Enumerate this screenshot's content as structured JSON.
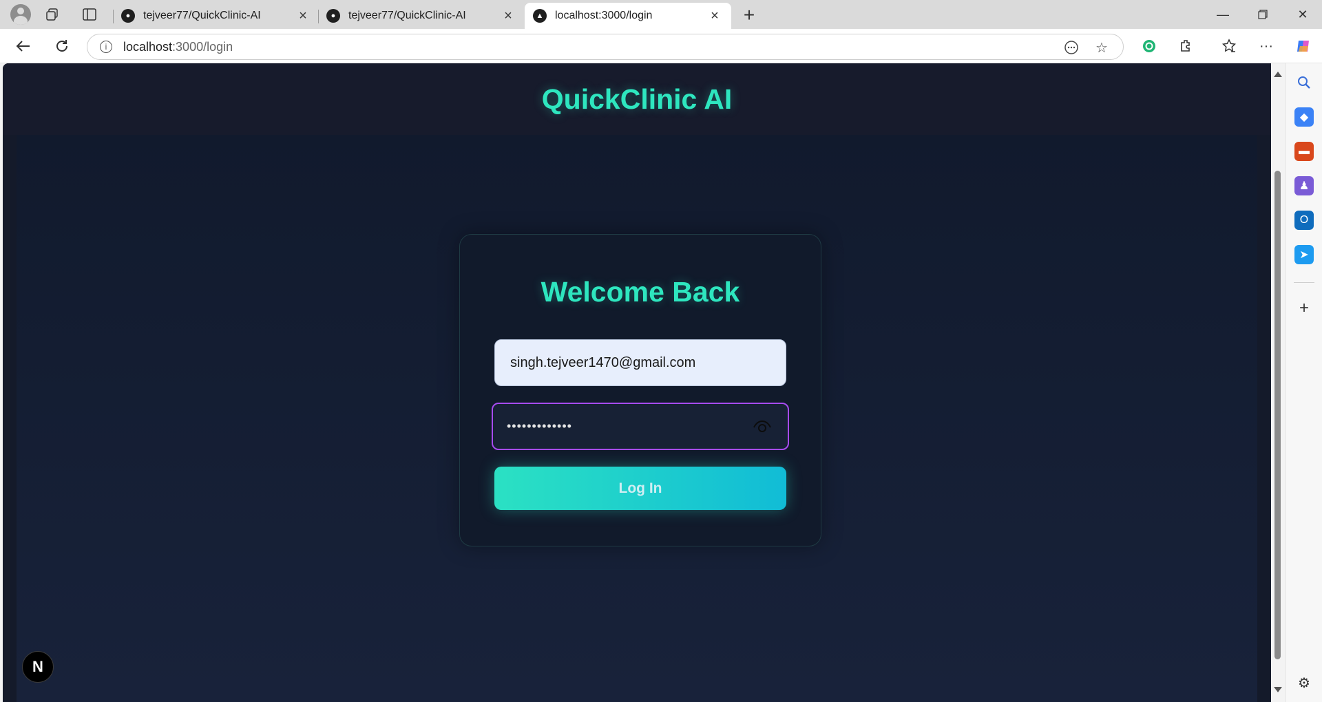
{
  "browser": {
    "tabs": [
      {
        "title": "tejveer77/QuickClinic-AI",
        "favicon": "github-icon",
        "active": false
      },
      {
        "title": "tejveer77/QuickClinic-AI",
        "favicon": "github-icon",
        "active": false
      },
      {
        "title": "localhost:3000/login",
        "favicon": "nextjs-icon",
        "active": true
      }
    ],
    "address": {
      "host": "localhost",
      "path": ":3000/login"
    }
  },
  "app": {
    "brand": "QuickClinic AI",
    "login": {
      "title": "Welcome Back",
      "email_value": "singh.tejveer1470@gmail.com",
      "password_mask": "•••••••••••••",
      "button_label": "Log In"
    },
    "dev_badge": "N"
  },
  "colors": {
    "accent": "#2ee6bf",
    "password_focus_border": "#a74bf0",
    "page_bg": "#141a2a",
    "button_gradient_start": "#2be1c3",
    "button_gradient_end": "#11bcd6"
  }
}
